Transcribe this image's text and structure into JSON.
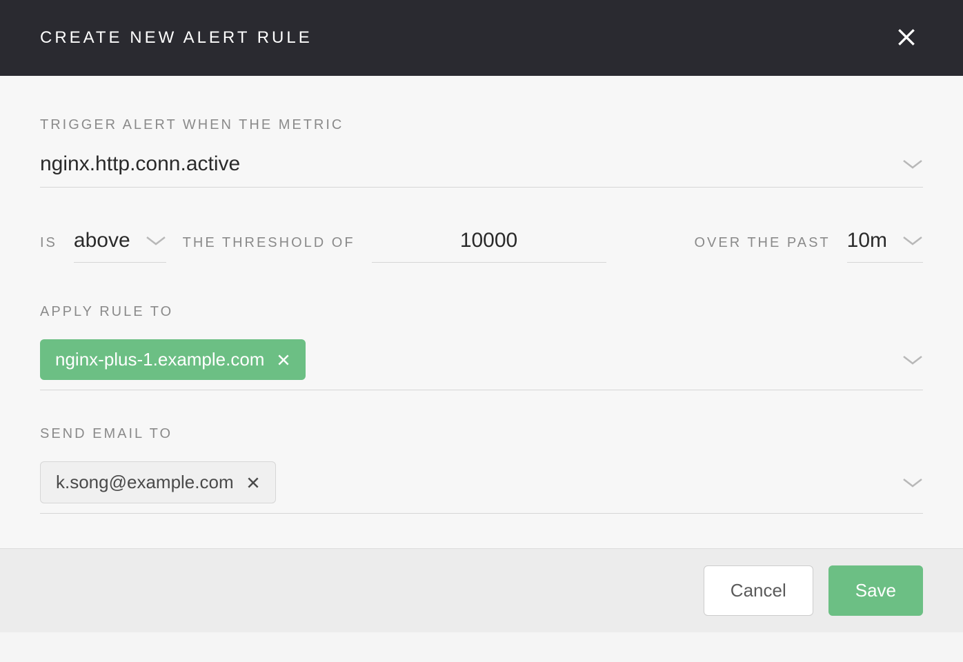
{
  "header": {
    "title": "CREATE NEW ALERT RULE"
  },
  "metric": {
    "label": "TRIGGER ALERT WHEN THE METRIC",
    "value": "nginx.http.conn.active"
  },
  "condition": {
    "is_label": "IS",
    "operator": "above",
    "threshold_label": "THE THRESHOLD OF",
    "threshold_value": "10000",
    "over_label": "OVER THE PAST",
    "duration": "10m"
  },
  "apply": {
    "label": "APPLY RULE TO",
    "tag": "nginx-plus-1.example.com"
  },
  "email": {
    "label": "SEND EMAIL TO",
    "tag": "k.song@example.com"
  },
  "footer": {
    "cancel": "Cancel",
    "save": "Save"
  }
}
